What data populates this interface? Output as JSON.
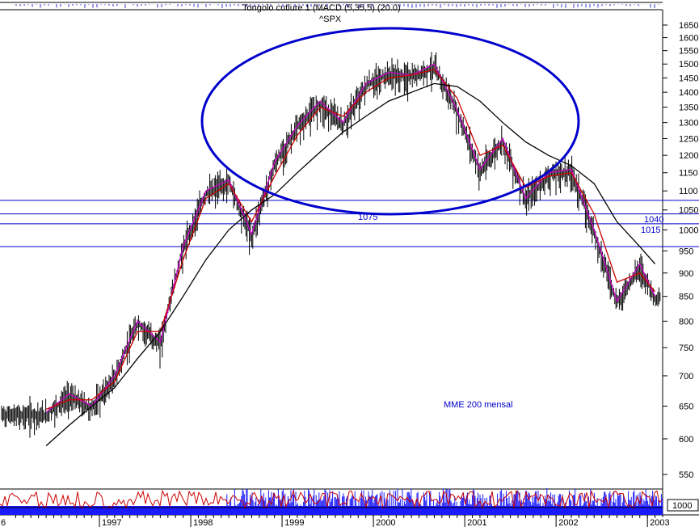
{
  "chart_data": {
    "type": "line",
    "title": "Tongolo cutlure 1 (MACD (5,35,5) (20.0)",
    "subtitle": "^SPX",
    "y_ticks": [
      550,
      600,
      650,
      700,
      750,
      800,
      850,
      900,
      950,
      1000,
      1050,
      1100,
      1150,
      1200,
      1250,
      1300,
      1350,
      1400,
      1450,
      1500,
      1550,
      1600,
      1650
    ],
    "ylim": [
      520,
      1700
    ],
    "y_scale": "log",
    "x_ticks": [
      "6",
      "1997",
      "1998",
      "1999",
      "2000",
      "2001",
      "2002",
      "2003"
    ],
    "x": [
      "1996-06",
      "1996-09",
      "1996-12",
      "1997-03",
      "1997-06",
      "1997-09",
      "1997-12",
      "1998-03",
      "1998-06",
      "1998-09",
      "1998-12",
      "1999-03",
      "1999-06",
      "1999-09",
      "1999-12",
      "2000-03",
      "2000-06",
      "2000-09",
      "2000-12",
      "2001-03",
      "2001-06",
      "2001-09",
      "2001-12",
      "2002-03",
      "2002-06",
      "2002-09",
      "2002-12",
      "2003-02"
    ],
    "series": [
      {
        "name": "",
        "color": "#cc00cc",
        "values": [
          640,
          670,
          650,
          700,
          800,
          760,
          960,
          1100,
          1130,
          990,
          1180,
          1290,
          1370,
          1300,
          1430,
          1470,
          1460,
          1500,
          1340,
          1160,
          1250,
          1080,
          1150,
          1160,
          1000,
          840,
          920,
          850
        ]
      },
      {
        "name": "",
        "color": "#cc0000",
        "values": [
          645,
          660,
          660,
          690,
          780,
          780,
          930,
          1080,
          1120,
          1020,
          1140,
          1260,
          1350,
          1320,
          1400,
          1450,
          1460,
          1480,
          1380,
          1200,
          1230,
          1110,
          1140,
          1150,
          1040,
          880,
          900,
          860
        ]
      },
      {
        "name": "",
        "color": "#000000",
        "values": [
          590,
          620,
          650,
          680,
          730,
          780,
          850,
          930,
          1000,
          1050,
          1090,
          1150,
          1210,
          1270,
          1320,
          1370,
          1400,
          1430,
          1420,
          1370,
          1300,
          1240,
          1200,
          1170,
          1120,
          1020,
          960,
          920
        ]
      }
    ],
    "horizontal_lines": [
      1075,
      1040,
      1015,
      960
    ],
    "annotations": [
      {
        "text": "1075",
        "y": 1075
      },
      {
        "text": "1040",
        "y": 1040
      },
      {
        "text": "1015",
        "y": 1015
      },
      {
        "text": "MME 200 mensal"
      }
    ],
    "lower_panel_labels": [
      "1000"
    ],
    "grid": false,
    "colors": {
      "annotation": "#0000cc",
      "ellipse": "#0000cc"
    }
  }
}
